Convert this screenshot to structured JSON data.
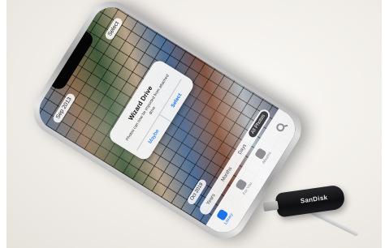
{
  "photo": {
    "description_colors": {
      "background": "#f1eee9",
      "phone_frame": "#c8c8c8",
      "usb_body": "#111113"
    }
  },
  "screen": {
    "top_left_chip": "Sep 2013",
    "top_right_chip": "Select",
    "dialog": {
      "title": "Wizard Drive",
      "message": "Photos can now be imported from attached drive",
      "buttons": [
        "Maybe",
        "Select"
      ]
    },
    "date_chip": "Oct 2019",
    "segments": [
      "Years",
      "Months",
      "Days",
      "All Photos"
    ],
    "active_segment": 3,
    "tabs": [
      {
        "label": "Library",
        "icon": "photos-icon"
      },
      {
        "label": "For You",
        "icon": "heart-icon"
      },
      {
        "label": "Albums",
        "icon": "albums-icon"
      },
      {
        "label": "",
        "icon": "search-icon"
      }
    ]
  },
  "usb": {
    "brand": "SanDisk"
  }
}
